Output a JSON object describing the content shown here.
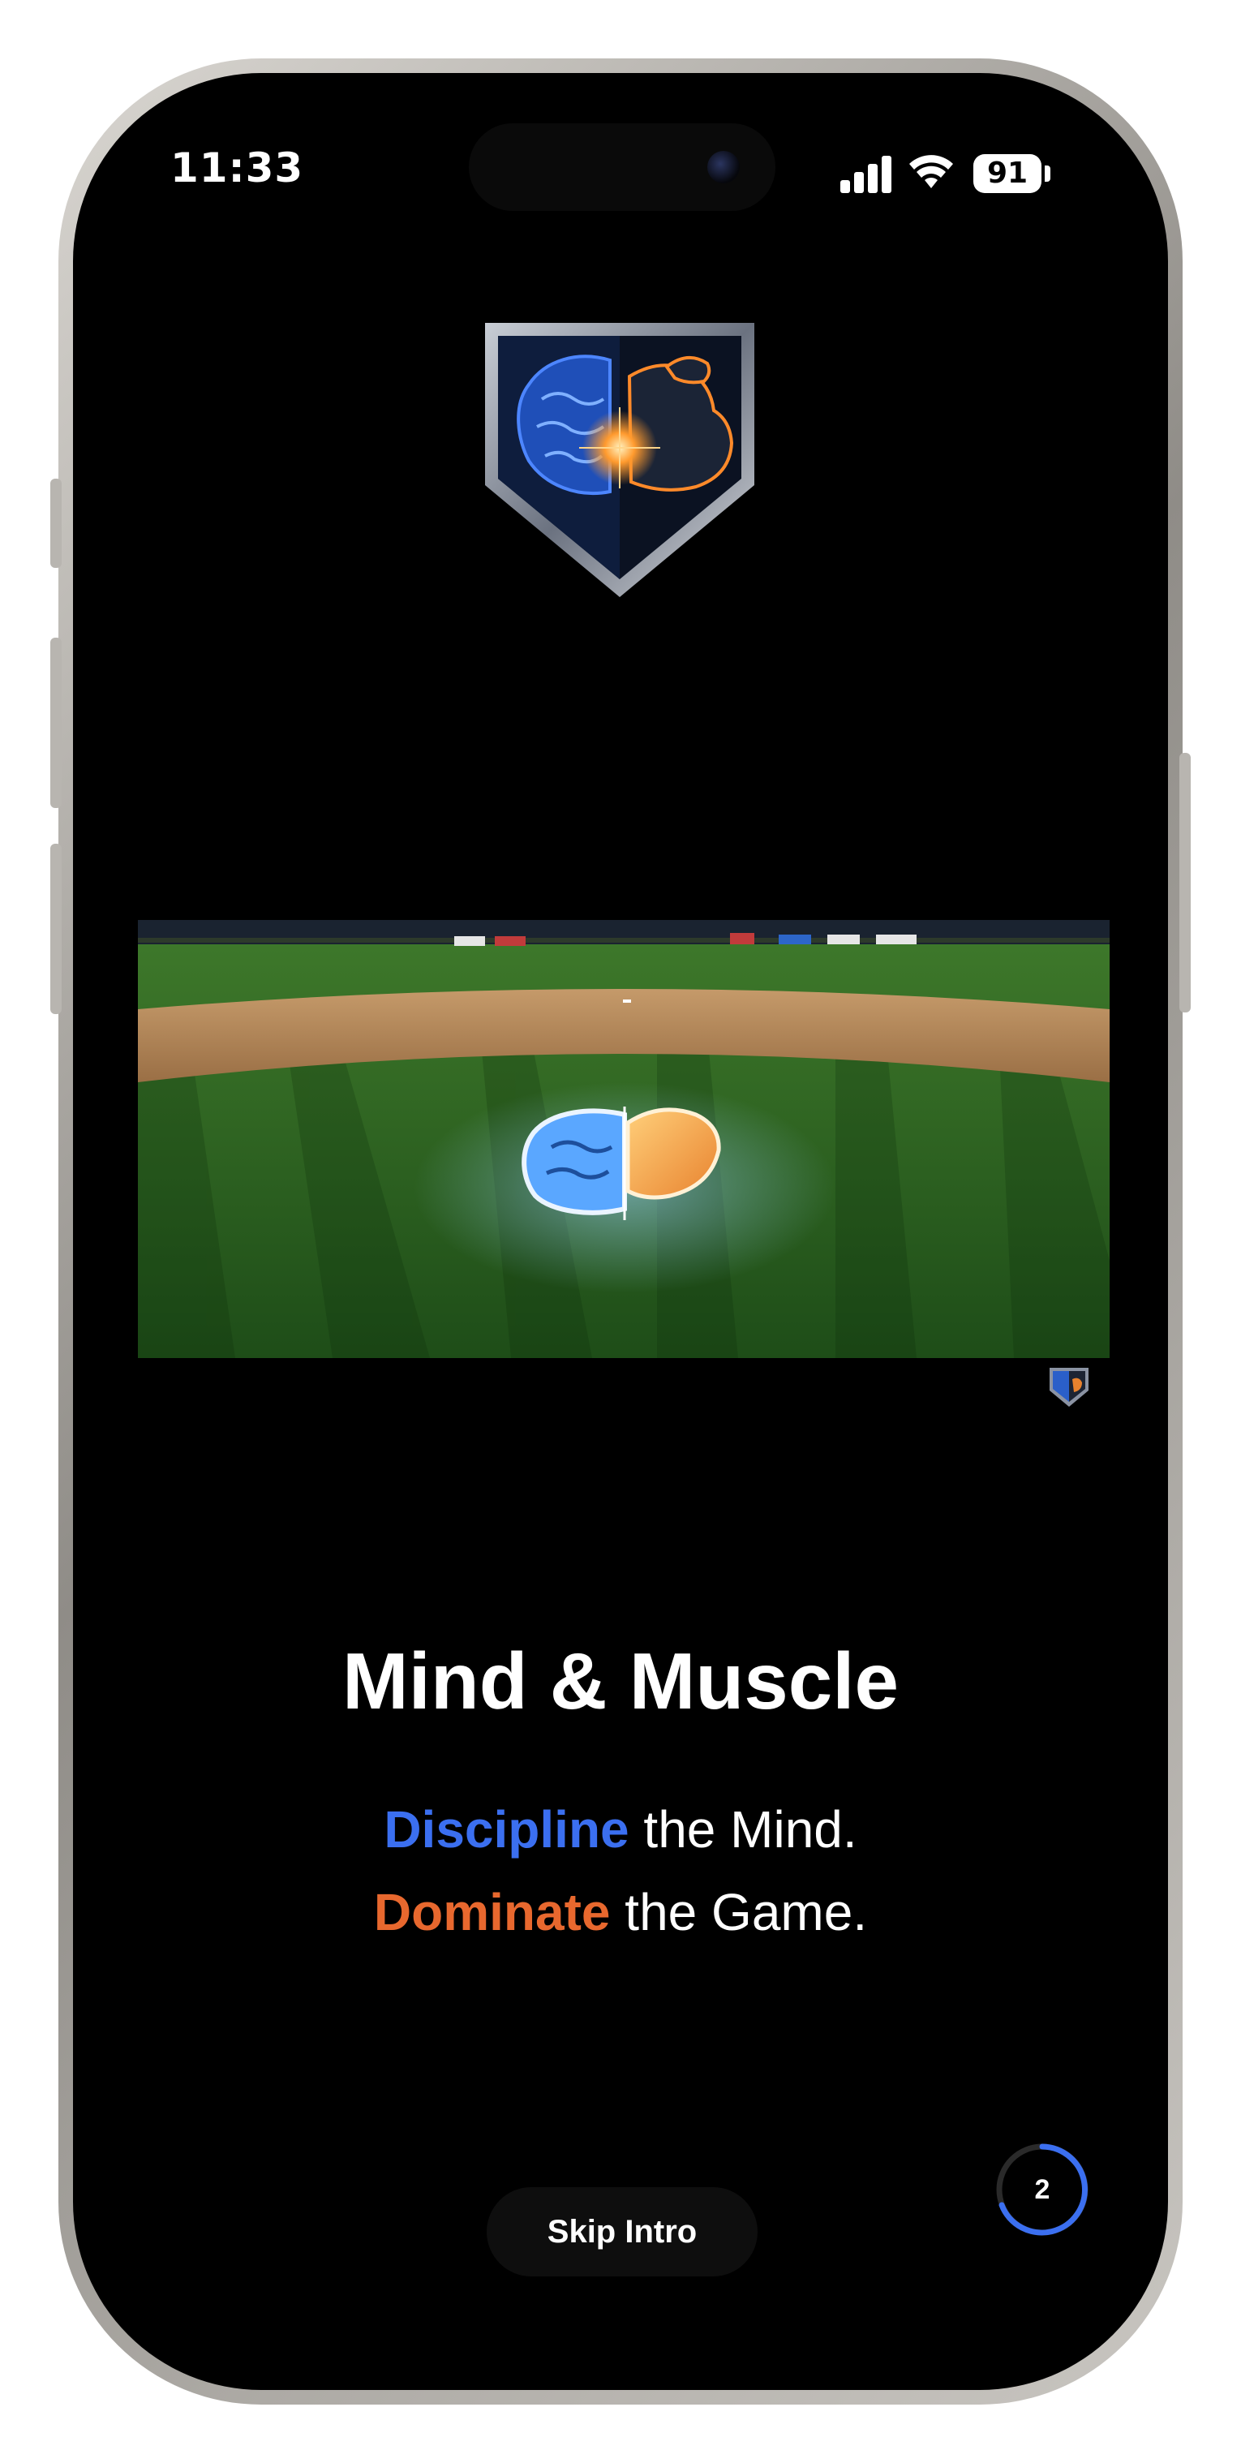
{
  "status_bar": {
    "time": "11:33",
    "battery": "91"
  },
  "app": {
    "title": "Mind & Muscle",
    "tagline_line1": {
      "accent": "Discipline",
      "rest": " the Mind."
    },
    "tagline_line2": {
      "accent": "Dominate",
      "rest": " the Game."
    },
    "accent_blue": "#3b6ff0",
    "accent_orange": "#e8682e"
  },
  "controls": {
    "skip_label": "Skip Intro",
    "countdown": "2"
  }
}
